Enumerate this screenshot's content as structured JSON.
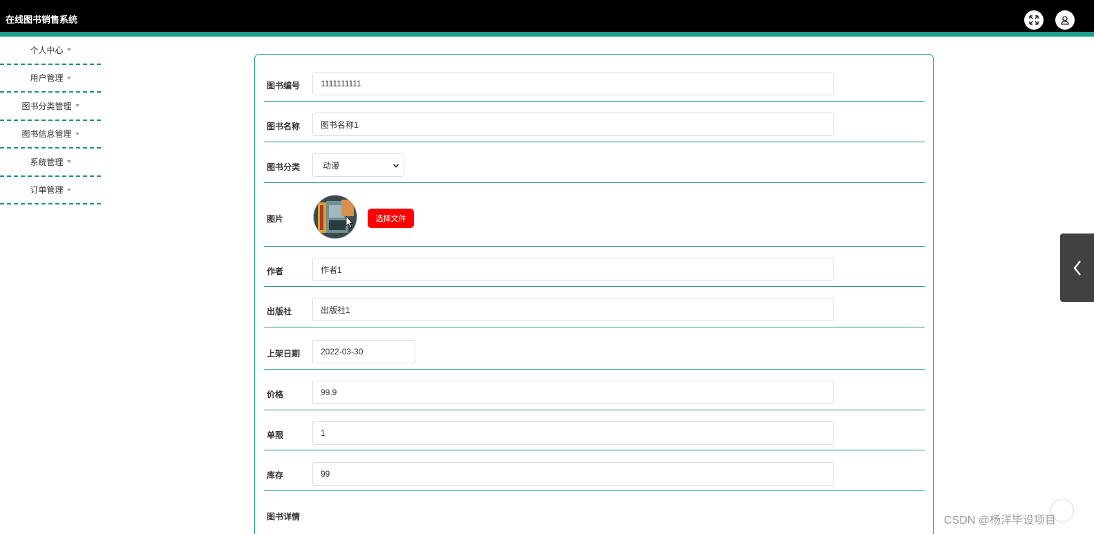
{
  "app": {
    "title": "在线图书销售系统"
  },
  "topbar": {
    "icons": [
      "fullscreen-icon",
      "user-icon"
    ]
  },
  "sidebar": {
    "items": [
      {
        "label": "个人中心"
      },
      {
        "label": "用户管理"
      },
      {
        "label": "图书分类管理"
      },
      {
        "label": "图书信息管理"
      },
      {
        "label": "系统管理"
      },
      {
        "label": "订单管理"
      }
    ]
  },
  "form": {
    "book_no": {
      "label": "图书编号",
      "value": "1111111111"
    },
    "book_name": {
      "label": "图书名称",
      "value": "图书名称1"
    },
    "category": {
      "label": "图书分类",
      "value": "动漫"
    },
    "image": {
      "label": "图片",
      "button_label": "选择文件"
    },
    "author": {
      "label": "作者",
      "value": "作者1"
    },
    "publisher": {
      "label": "出版社",
      "value": "出版社1"
    },
    "listing_date": {
      "label": "上架日期",
      "value": "2022-03-30"
    },
    "price": {
      "label": "价格",
      "value": "99.9"
    },
    "limit": {
      "label": "单限",
      "value": "1"
    },
    "stock": {
      "label": "库存",
      "value": "99"
    },
    "details": {
      "label": "图书详情"
    }
  },
  "watermark": "CSDN @杨洋毕设项目",
  "colors": {
    "accent": "#1d9d8d",
    "topbar": "#000000",
    "danger": "#ff0000"
  }
}
